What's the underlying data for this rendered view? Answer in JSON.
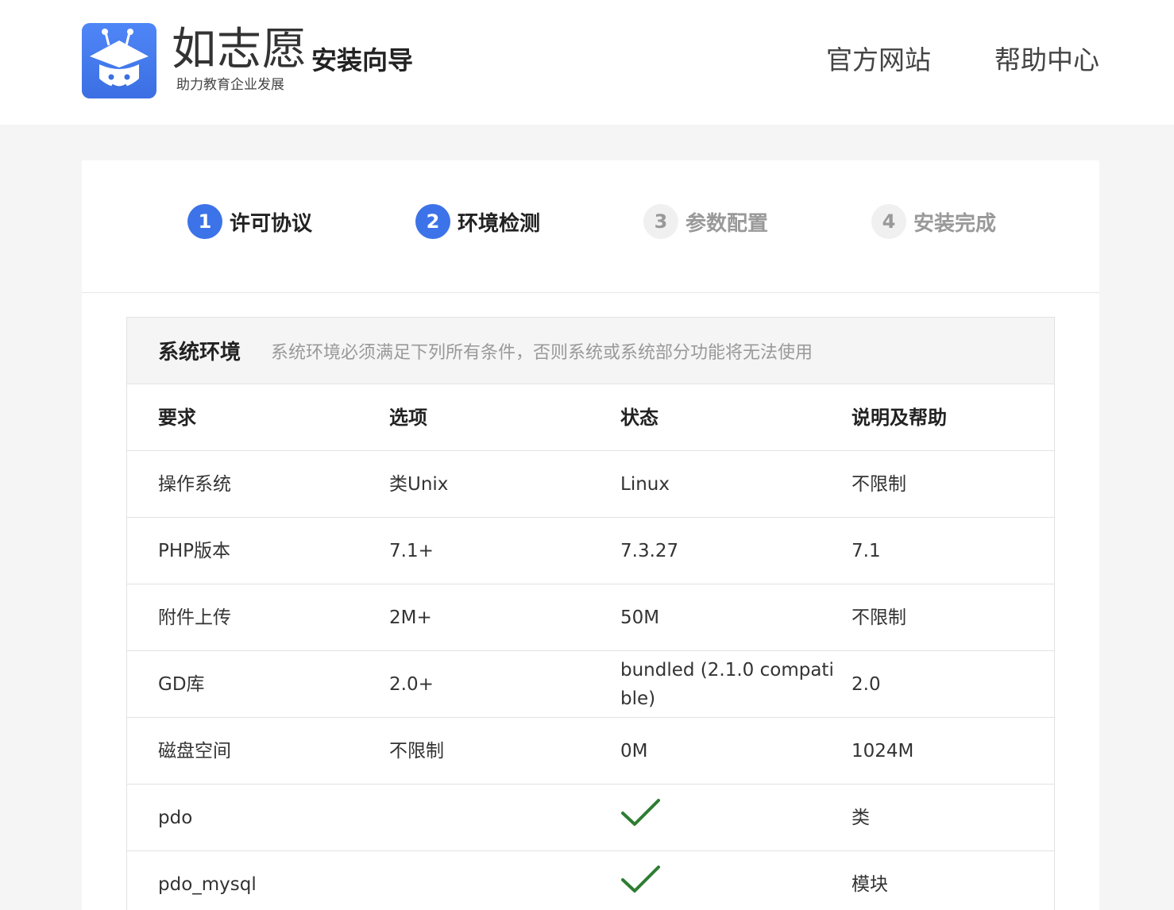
{
  "header": {
    "brand_name": "如志愿",
    "brand_slogan": "助力教育企业发展",
    "wizard_title": "安装向导",
    "nav": {
      "official_site": "官方网站",
      "help_center": "帮助中心"
    }
  },
  "steps": [
    {
      "num": "1",
      "label": "许可协议",
      "state": "active"
    },
    {
      "num": "2",
      "label": "环境检测",
      "state": "active"
    },
    {
      "num": "3",
      "label": "参数配置",
      "state": "inactive"
    },
    {
      "num": "4",
      "label": "安装完成",
      "state": "inactive"
    }
  ],
  "section": {
    "title": "系统环境",
    "description": "系统环境必须满足下列所有条件，否则系统或系统部分功能将无法使用"
  },
  "table": {
    "headers": [
      "要求",
      "选项",
      "状态",
      "说明及帮助"
    ],
    "rows": [
      [
        "操作系统",
        "类Unix",
        "Linux",
        "不限制"
      ],
      [
        "PHP版本",
        "7.1+",
        "7.3.27",
        "7.1"
      ],
      [
        "附件上传",
        "2M+",
        "50M",
        "不限制"
      ],
      [
        "GD库",
        "2.0+",
        "bundled (2.1.0 compatible)",
        "2.0"
      ],
      [
        "磁盘空间",
        "不限制",
        "0M",
        "1024M"
      ],
      [
        "pdo",
        "",
        "check",
        "类"
      ],
      [
        "pdo_mysql",
        "",
        "check",
        "模块"
      ]
    ]
  },
  "colors": {
    "accent": "#3d73e8",
    "check": "#2e7d32"
  }
}
